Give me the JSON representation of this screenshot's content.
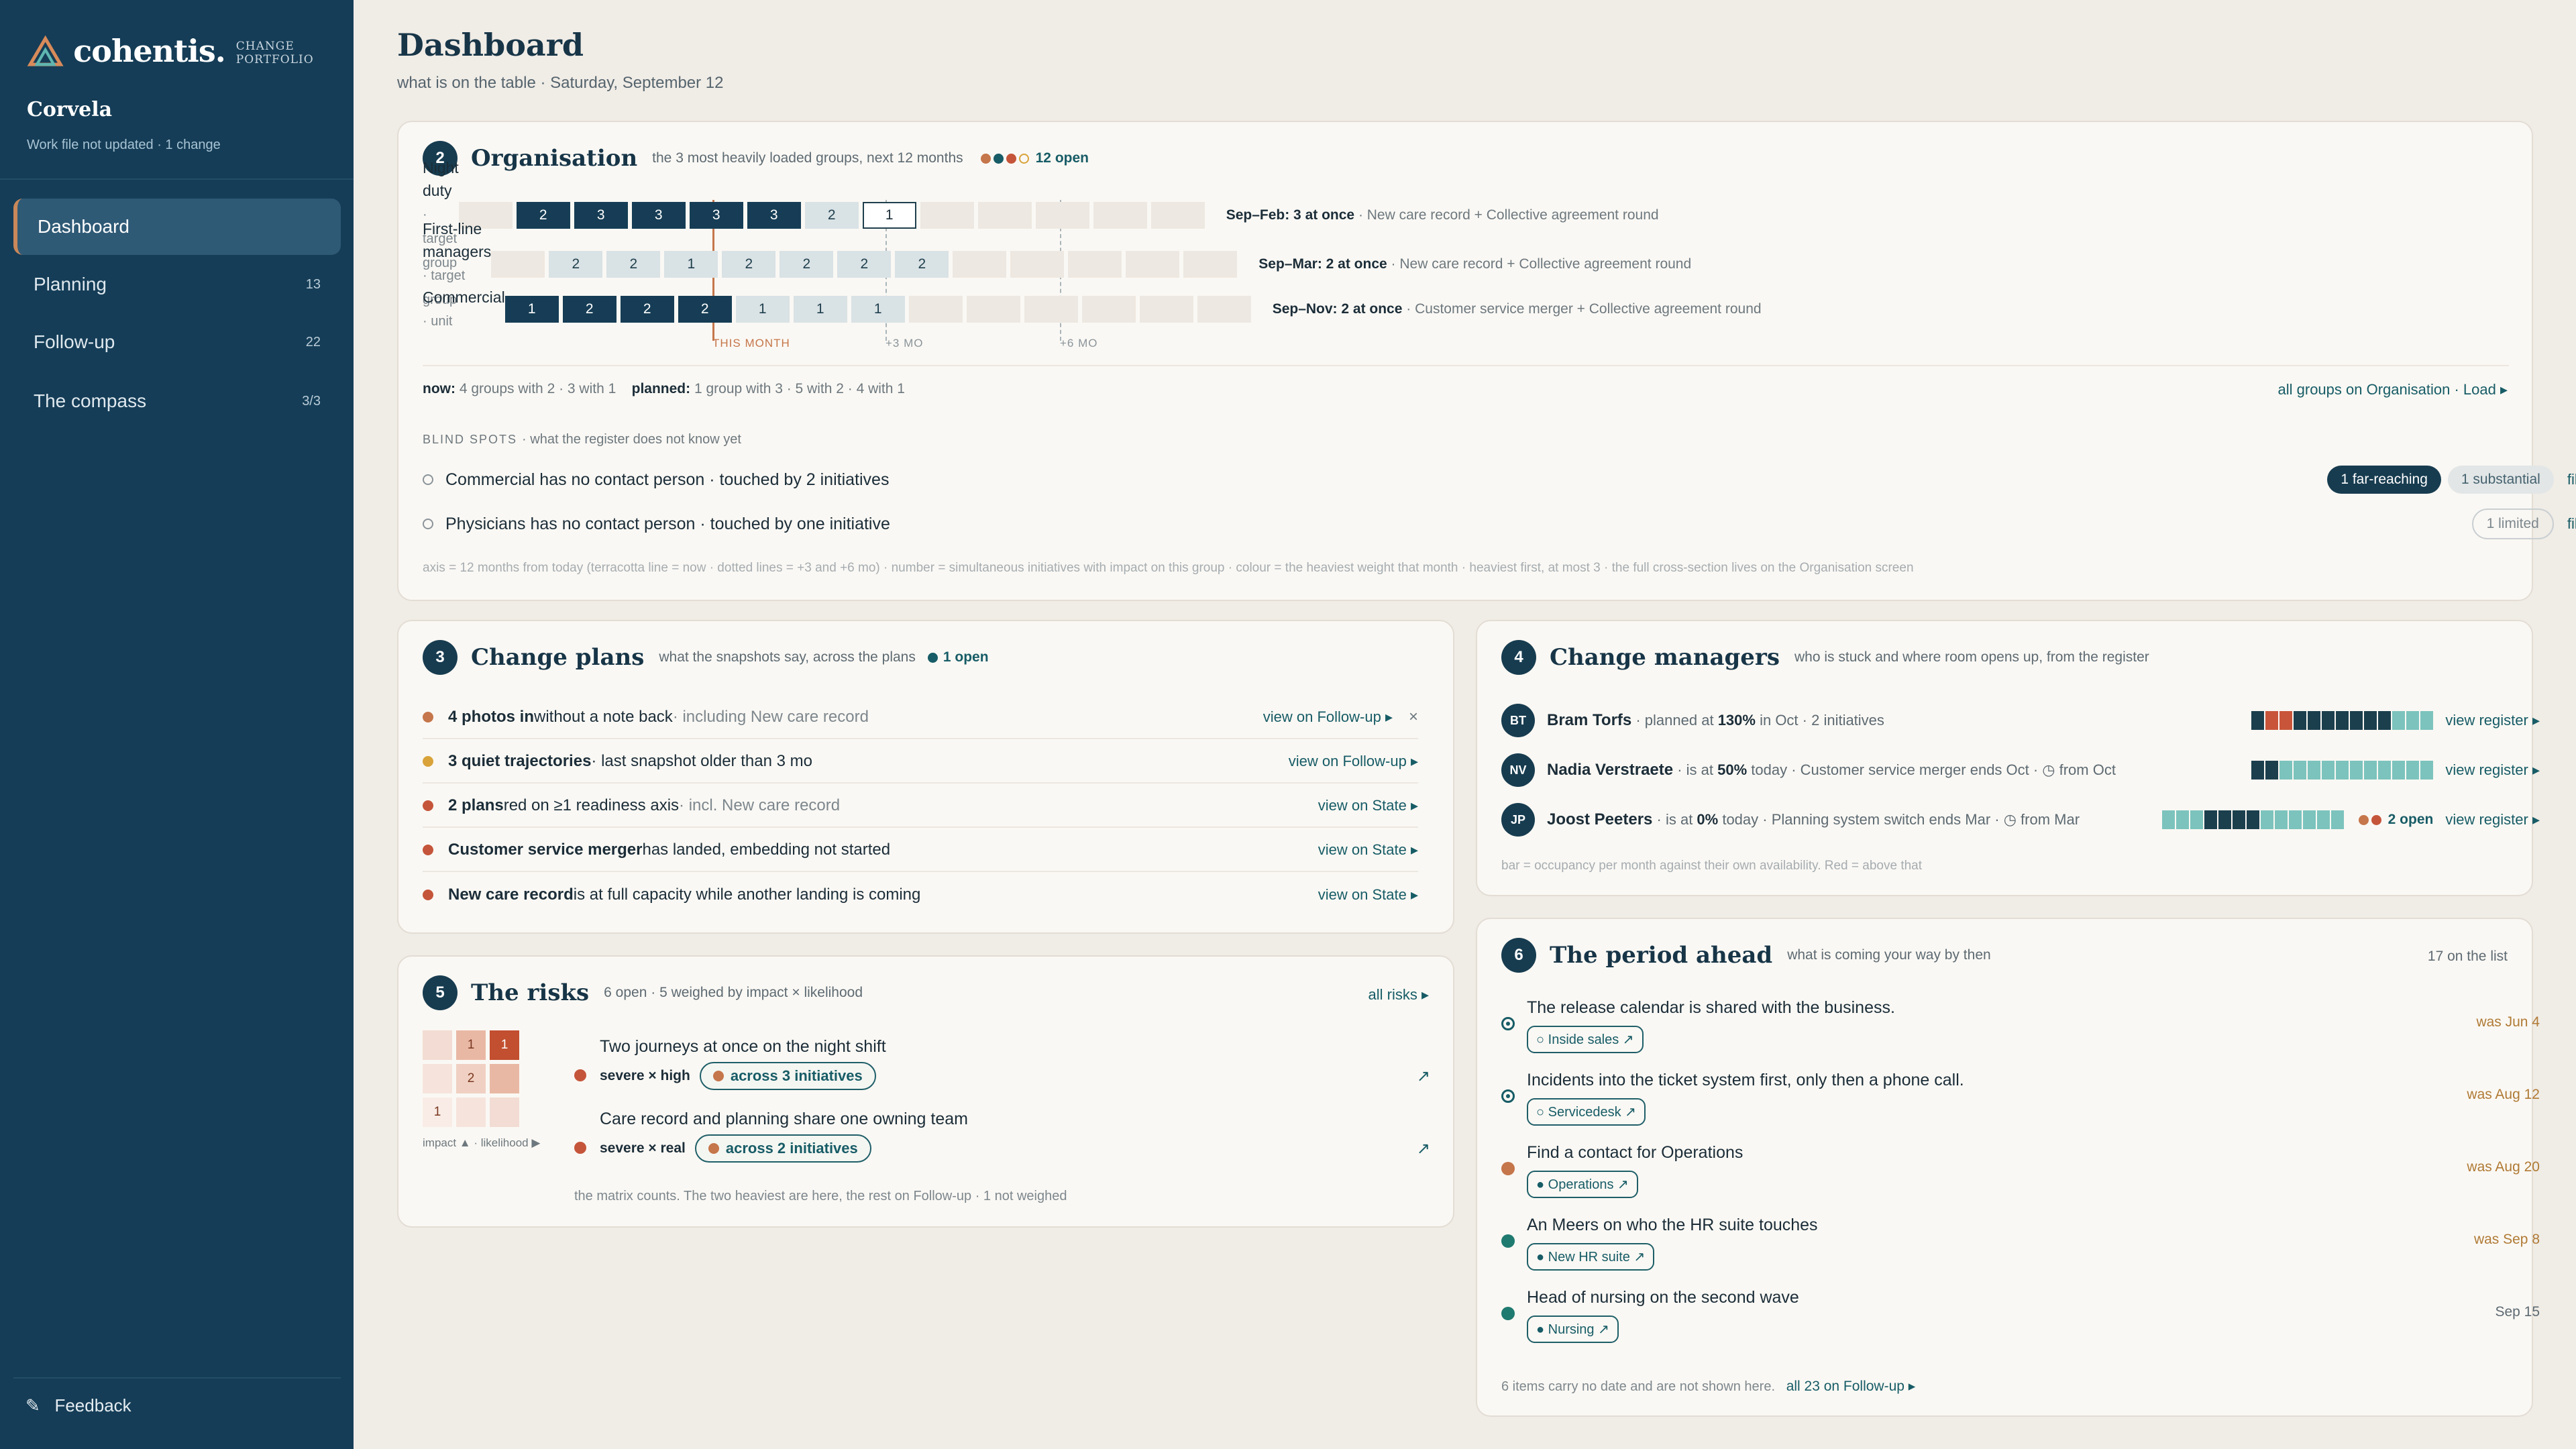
{
  "app": {
    "brand": "cohentis.",
    "brand_sub": "CHANGE PORTFOLIO",
    "org": "Corvela",
    "status": "Work file not updated · 1 change",
    "feedback": "Feedback"
  },
  "colors": {
    "sidebar": "#153d57",
    "accent": "#c5764a",
    "teal": "#175c66",
    "dark": "#163d55"
  },
  "nav": [
    {
      "label": "Dashboard",
      "count": "",
      "active": true
    },
    {
      "label": "Planning",
      "count": "13"
    },
    {
      "label": "Follow-up",
      "count": "22"
    },
    {
      "label": "The compass",
      "count": "3/3"
    }
  ],
  "header": {
    "title": "Dashboard",
    "subtitle": "what is on the table · Saturday, September 12"
  },
  "org": {
    "num": "2",
    "title": "Organisation",
    "sub": "the 3 most heavily loaded groups, next 12 months",
    "open": "12 open",
    "groups": [
      {
        "name": "Night duty",
        "kind": "· target group",
        "cells": [
          "",
          "2",
          "3",
          "3",
          "3",
          "3",
          "2",
          "1",
          "",
          "",
          "",
          "",
          ""
        ],
        "range": "Sep–Feb: 3 at once",
        "detail": "· New care record + Collective agreement round"
      },
      {
        "name": "First-line managers",
        "kind": "· target group",
        "cells": [
          "",
          "2",
          "2",
          "1",
          "2",
          "2",
          "2",
          "2",
          "",
          "",
          "",
          "",
          ""
        ],
        "range": "Sep–Mar: 2 at once",
        "detail": "· New care record + Collective agreement round"
      },
      {
        "name": "Commercial",
        "kind": "· unit",
        "cells": [
          "1",
          "2",
          "2",
          "2",
          "1",
          "1",
          "1",
          "",
          "",
          "",
          "",
          "",
          ""
        ],
        "range": "Sep–Nov: 2 at once",
        "detail": "· Customer service merger + Collective agreement round"
      }
    ],
    "axis": {
      "now": "THIS MONTH",
      "m3": "+3 MO",
      "m6": "+6 MO"
    },
    "now_label": "now:",
    "now_text": "4 groups with 2 · 3 with 1",
    "planned_label": "planned:",
    "planned_text": "1 group with 3 · 5 with 2 · 4 with 1",
    "all_link": "all groups on Organisation · Load ▸",
    "blind_title": "BLIND SPOTS",
    "blind_sub": "· what the register does not know yet",
    "blind": [
      {
        "text": "Commercial has no contact person · touched by 2 initiatives",
        "p1": "1 far-reaching",
        "p2": "1 substantial",
        "fill": "fill in ▸"
      },
      {
        "text": "Physicians has no contact person · touched by one initiative",
        "p1": "1 limited",
        "fill": "fill in ▸"
      }
    ],
    "footnote": "axis = 12 months from today (terracotta line = now · dotted lines = +3 and +6 mo) · number = simultaneous initiatives with impact on this group · colour = the heaviest weight that month · heaviest first, at most 3 · the full cross-section lives on the Organisation screen"
  },
  "plans": {
    "num": "3",
    "title": "Change plans",
    "sub": "what the snapshots say, across the plans",
    "open": "1 open",
    "items": [
      {
        "bold": "4 photos in",
        "rest": " without a note back",
        "muted": " · including New care record",
        "link": "view on Follow-up ▸",
        "close": "×",
        "color": "#c5764a"
      },
      {
        "bold": "3 quiet trajectories",
        "rest": " · last snapshot older than 3 mo",
        "muted": "",
        "link": "view on Follow-up ▸",
        "color": "#d9a33a"
      },
      {
        "bold": "2 plans",
        "rest": " red on ≥1 readiness axis",
        "muted": " · incl. New care record",
        "link": "view on State ▸",
        "color": "#c5553a"
      },
      {
        "bold": "Customer service merger",
        "rest": " has landed, embedding not started",
        "muted": "",
        "link": "view on State ▸",
        "color": "#c5553a"
      },
      {
        "bold": "New care record",
        "rest": " is at full capacity while another landing is coming",
        "muted": "",
        "link": "view on State ▸",
        "color": "#c5553a"
      }
    ]
  },
  "risks": {
    "num": "5",
    "title": "The risks",
    "sub": "6 open · 5 weighed by impact × likelihood",
    "all": "all risks ▸",
    "matrix": [
      "",
      "1",
      "1",
      "",
      "2",
      "",
      "1",
      "",
      ""
    ],
    "matrix_label": "impact ▲ · likelihood ▶",
    "items": [
      {
        "title": "Two journeys at once on the night shift",
        "sev": "severe × high",
        "tag": "across 3 initiatives"
      },
      {
        "title": "Care record and planning share one owning team",
        "sev": "severe × real",
        "tag": "across 2 initiatives"
      }
    ],
    "arrow": "↗",
    "footnote": "the matrix counts. The two heaviest are here, the rest on Follow-up · 1 not weighed"
  },
  "managers": {
    "num": "4",
    "title": "Change managers",
    "sub": "who is stuck and where room opens up, from the register",
    "people": [
      {
        "initials": "BT",
        "name": "Bram Torfs",
        "pre": " · planned at ",
        "pct": "130%",
        "post": " in Oct · 2 initiatives",
        "extra": "",
        "link": "view register ▸"
      },
      {
        "initials": "NV",
        "name": "Nadia Verstraete",
        "pre": " · is at ",
        "pct": "50%",
        "post": " today · Customer service merger ends Oct · ◷ from Oct",
        "extra": "",
        "link": "view register ▸"
      },
      {
        "initials": "JP",
        "name": "Joost Peeters",
        "pre": " · is at ",
        "pct": "0%",
        "post": " today · Planning system switch ends Mar · ◷ from Mar",
        "extra": "2 open",
        "link": "view register ▸"
      }
    ],
    "bars": [
      [
        "d",
        "r",
        "r",
        "d",
        "d",
        "d",
        "d",
        "d",
        "d",
        "d",
        "t",
        "t",
        "t"
      ],
      [
        "d",
        "d",
        "t",
        "t",
        "t",
        "t",
        "t",
        "t",
        "t",
        "t",
        "t",
        "t",
        "t"
      ],
      [
        "t",
        "t",
        "t",
        "d",
        "d",
        "d",
        "d",
        "t",
        "t",
        "t",
        "t",
        "t",
        "t"
      ]
    ],
    "footnote": "bar = occupancy per month against their own availability. Red = above that"
  },
  "period": {
    "num": "6",
    "title": "The period ahead",
    "sub": "what is coming your way by then",
    "count": "17 on the list",
    "items": [
      {
        "title": "The release calendar is shared with the business.",
        "tag": "○ Inside sales ↗",
        "date": "was Jun 4",
        "marker": "ring"
      },
      {
        "title": "Incidents into the ticket system first, only then a phone call.",
        "tag": "○ Servicedesk ↗",
        "date": "was Aug 12",
        "marker": "ring"
      },
      {
        "title": "Find a contact for Operations",
        "tag": "● Operations ↗",
        "date": "was Aug 20",
        "marker": "orange"
      },
      {
        "title": "An Meers on who the HR suite touches",
        "tag": "● New HR suite ↗",
        "date": "was Sep 8",
        "marker": "teal"
      },
      {
        "title": "Head of nursing on the second wave",
        "tag": "● Nursing ↗",
        "date": "Sep 15",
        "marker": "teal"
      }
    ],
    "foot": "6 items carry no date and are not shown here.",
    "foot_link": "all 23 on Follow-up ▸"
  }
}
